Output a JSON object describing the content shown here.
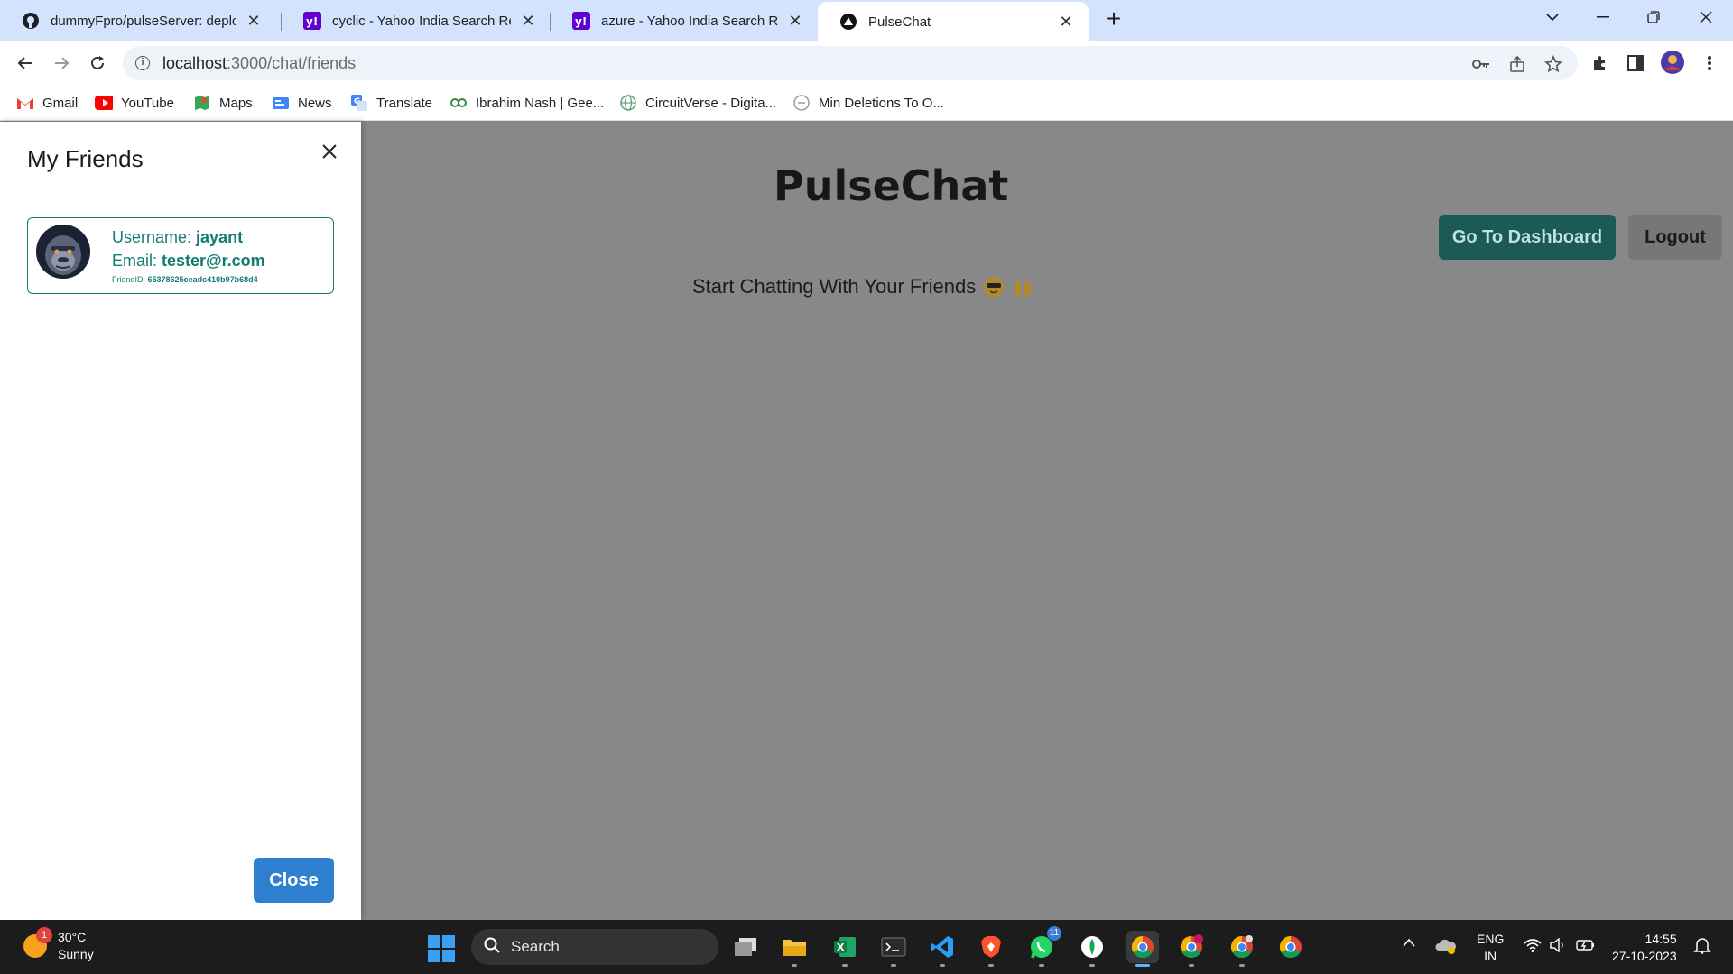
{
  "browser": {
    "tabs": [
      {
        "title": "dummyFpro/pulseServer: deploy",
        "icon": "github-icon"
      },
      {
        "title": "cyclic - Yahoo India Search Resul",
        "icon": "yahoo-icon"
      },
      {
        "title": "azure - Yahoo India Search Resu",
        "icon": "yahoo-icon"
      },
      {
        "title": "PulseChat",
        "icon": "pulsechat-icon"
      }
    ],
    "url_host": "localhost",
    "url_path": ":3000/chat/friends",
    "bookmarks": [
      {
        "label": "Gmail",
        "icon": "gmail-icon"
      },
      {
        "label": "YouTube",
        "icon": "youtube-icon"
      },
      {
        "label": "Maps",
        "icon": "maps-icon"
      },
      {
        "label": "News",
        "icon": "news-icon"
      },
      {
        "label": "Translate",
        "icon": "translate-icon"
      },
      {
        "label": "Ibrahim Nash | Gee...",
        "icon": "geeks-icon"
      },
      {
        "label": "CircuitVerse - Digita...",
        "icon": "globe-icon"
      },
      {
        "label": "Min Deletions To O...",
        "icon": "leetcode-icon"
      }
    ]
  },
  "app": {
    "title": "PulseChat",
    "dashboard_label": "Go To Dashboard",
    "logout_label": "Logout",
    "subtitle": "Start Chatting With Your Friends",
    "colors": {
      "accent": "#137c71",
      "dashboard_bg": "#1c5a56",
      "close_bg": "#2f7fd1"
    }
  },
  "drawer": {
    "title": "My Friends",
    "close_label": "Close",
    "friends": [
      {
        "username_label": "Username: ",
        "username": "jayant",
        "email_label": "Email: ",
        "email": "tester@r.com",
        "id_label": "FriendID: ",
        "id": "65378625ceadc410b97b68d4"
      }
    ]
  },
  "taskbar": {
    "temp": "30°C",
    "weather": "Sunny",
    "weather_badge": "1",
    "search_placeholder": "Search",
    "whatsapp_badge": "11",
    "lang1": "ENG",
    "lang2": "IN",
    "time": "14:55",
    "date": "27-10-2023"
  }
}
